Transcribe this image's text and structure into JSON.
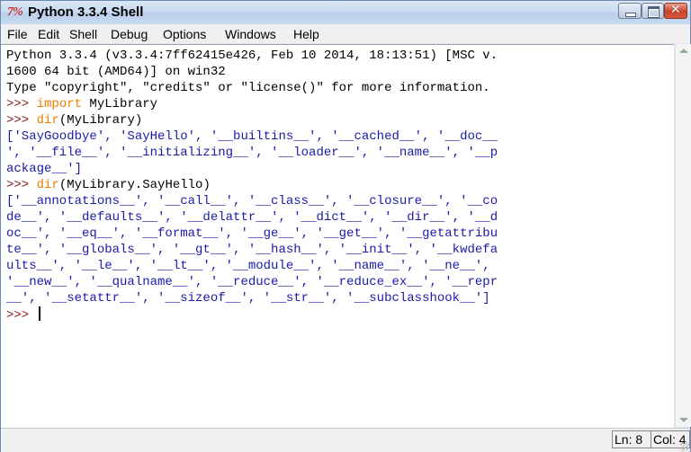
{
  "window": {
    "title": "Python 3.3.4 Shell",
    "icon_glyph": "7%",
    "icon_name": "python-tk-icon"
  },
  "menu": [
    "File",
    "Edit",
    "Shell",
    "Debug",
    "Options",
    "Windows",
    "Help"
  ],
  "shell": {
    "banner": [
      "Python 3.3.4 (v3.3.4:7ff62415e426, Feb 10 2014, 18:13:51) [MSC v.",
      "1600 64 bit (AMD64)] on win32",
      "Type \"copyright\", \"credits\" or \"license()\" for more information."
    ],
    "prompt": ">>> ",
    "cmd1_keyword": "import",
    "cmd1_rest": " MyLibrary",
    "cmd2_keyword": "dir",
    "cmd2_rest": "(MyLibrary)",
    "out2": [
      "['SayGoodbye', 'SayHello', '__builtins__', '__cached__', '__doc__",
      "', '__file__', '__initializing__', '__loader__', '__name__', '__p",
      "ackage__']"
    ],
    "cmd3_keyword": "dir",
    "cmd3_rest": "(MyLibrary.SayHello)",
    "out3": [
      "['__annotations__', '__call__', '__class__', '__closure__', '__co",
      "de__', '__defaults__', '__delattr__', '__dict__', '__dir__', '__d",
      "oc__', '__eq__', '__format__', '__ge__', '__get__', '__getattribu",
      "te__', '__globals__', '__gt__', '__hash__', '__init__', '__kwdefa",
      "ults__', '__le__', '__lt__', '__module__', '__name__', '__ne__',",
      "'__new__', '__qualname__', '__reduce__', '__reduce_ex__', '__repr",
      "__', '__setattr__', '__sizeof__', '__str__', '__subclasshook__']"
    ],
    "final_prompt": ">>> "
  },
  "status": {
    "line": "Ln: 8",
    "col": "Col: 4"
  },
  "colors": {
    "prompt": "#8b1a1a",
    "keyword": "#f07b00",
    "output": "#1a1aa8",
    "close_button": "#c7432c"
  }
}
